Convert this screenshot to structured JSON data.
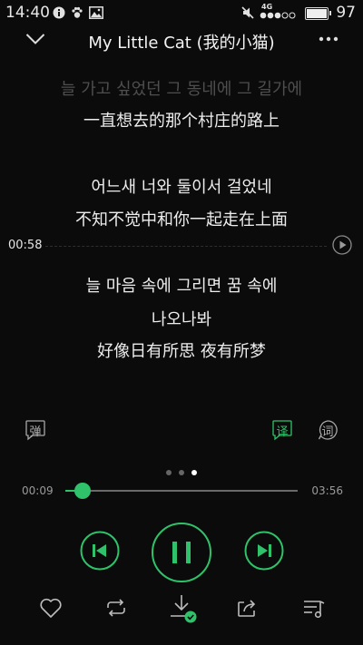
{
  "status_bar": {
    "time": "14:40",
    "network": "4G",
    "battery": "97"
  },
  "header": {
    "title": "My Little Cat (我的小猫)"
  },
  "lyrics": [
    {
      "text": "늘 가고 싶었던 그 동네에 그 길가에",
      "state": "dim"
    },
    {
      "text": "一直想去的那个村庄的路上",
      "state": "bright"
    },
    {
      "text": "어느새 너와 둘이서 걸었네",
      "state": "bright"
    },
    {
      "text": "不知不觉中和你一起走在上面",
      "state": "bright"
    },
    {
      "text": "늘 마음 속에 그리면 꿈 속에",
      "state": "bright"
    },
    {
      "text": "나오나봐",
      "state": "bright"
    },
    {
      "text": "好像日有所思 夜有所梦",
      "state": "bright"
    }
  ],
  "lyric_marker": {
    "time": "00:58"
  },
  "tools": {
    "danmaku": "弹",
    "translate": "译",
    "lyrics": "词"
  },
  "pager": {
    "count": 3,
    "active_index": 2
  },
  "progress": {
    "current": "00:09",
    "total": "03:56",
    "fraction": 0.04
  },
  "colors": {
    "accent": "#2fc26a",
    "background": "#0b0b0b"
  },
  "icons": [
    "chevron-down-icon",
    "more-icon",
    "play-line-icon",
    "previous-icon",
    "pause-icon",
    "next-icon",
    "heart-icon",
    "repeat-icon",
    "download-icon",
    "share-icon",
    "playlist-icon"
  ]
}
